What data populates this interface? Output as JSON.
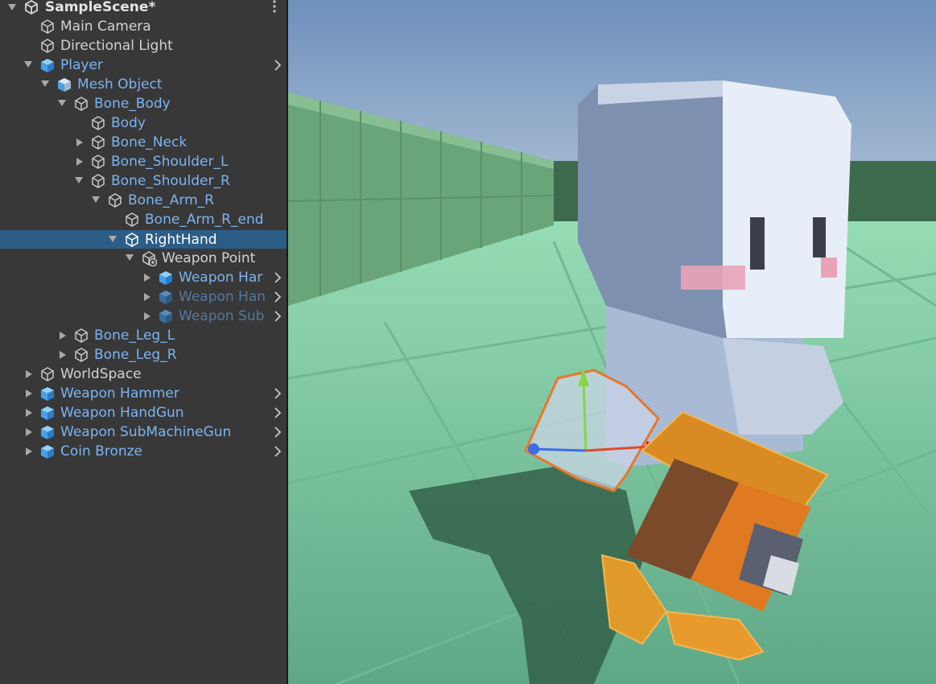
{
  "scene": {
    "name": "SampleScene*"
  },
  "hierarchy": [
    {
      "label": "Main Camera",
      "kind": "object",
      "indent": 1,
      "fold": "none"
    },
    {
      "label": "Directional Light",
      "kind": "object",
      "indent": 1,
      "fold": "none"
    },
    {
      "label": "Player",
      "kind": "prefab",
      "indent": 1,
      "fold": "open",
      "chevron": true
    },
    {
      "label": "Mesh Object",
      "kind": "prefab-part",
      "indent": 2,
      "fold": "open"
    },
    {
      "label": "Bone_Body",
      "kind": "child",
      "indent": 3,
      "fold": "open"
    },
    {
      "label": "Body",
      "kind": "child",
      "indent": 4,
      "fold": "none"
    },
    {
      "label": "Bone_Neck",
      "kind": "child",
      "indent": 4,
      "fold": "closed"
    },
    {
      "label": "Bone_Shoulder_L",
      "kind": "child",
      "indent": 4,
      "fold": "closed"
    },
    {
      "label": "Bone_Shoulder_R",
      "kind": "child",
      "indent": 4,
      "fold": "open"
    },
    {
      "label": "Bone_Arm_R",
      "kind": "child",
      "indent": 5,
      "fold": "open"
    },
    {
      "label": "Bone_Arm_R_end",
      "kind": "child",
      "indent": 6,
      "fold": "none"
    },
    {
      "label": "RightHand",
      "kind": "child",
      "indent": 6,
      "fold": "open",
      "selected": true
    },
    {
      "label": "Weapon Point",
      "kind": "added",
      "indent": 7,
      "fold": "open"
    },
    {
      "label": "Weapon Har",
      "kind": "prefab",
      "indent": 8,
      "fold": "closed",
      "chevron": true
    },
    {
      "label": "Weapon Han",
      "kind": "prefab-dim",
      "indent": 8,
      "fold": "closed",
      "chevron": true
    },
    {
      "label": "Weapon Sub",
      "kind": "prefab-dim",
      "indent": 8,
      "fold": "closed",
      "chevron": true
    },
    {
      "label": "Bone_Leg_L",
      "kind": "child",
      "indent": 3,
      "fold": "closed"
    },
    {
      "label": "Bone_Leg_R",
      "kind": "child",
      "indent": 3,
      "fold": "closed"
    },
    {
      "label": "WorldSpace",
      "kind": "object",
      "indent": 1,
      "fold": "closed"
    },
    {
      "label": "Weapon Hammer",
      "kind": "prefab",
      "indent": 1,
      "fold": "closed",
      "chevron": true
    },
    {
      "label": "Weapon HandGun",
      "kind": "prefab",
      "indent": 1,
      "fold": "closed",
      "chevron": true
    },
    {
      "label": "Weapon SubMachineGun",
      "kind": "prefab",
      "indent": 1,
      "fold": "closed",
      "chevron": true
    },
    {
      "label": "Coin Bronze",
      "kind": "prefab",
      "indent": 1,
      "fold": "closed",
      "chevron": true
    }
  ],
  "colors": {
    "panel": "#383838",
    "selection": "#2c5d87",
    "prefab_text": "#7cb4f2",
    "sky": "#7fa0c4",
    "ground": "#7bc7a0",
    "wall": "#6aa07a",
    "selection_outline": "#e8772a",
    "weapon_orange": "#e89a2c"
  }
}
